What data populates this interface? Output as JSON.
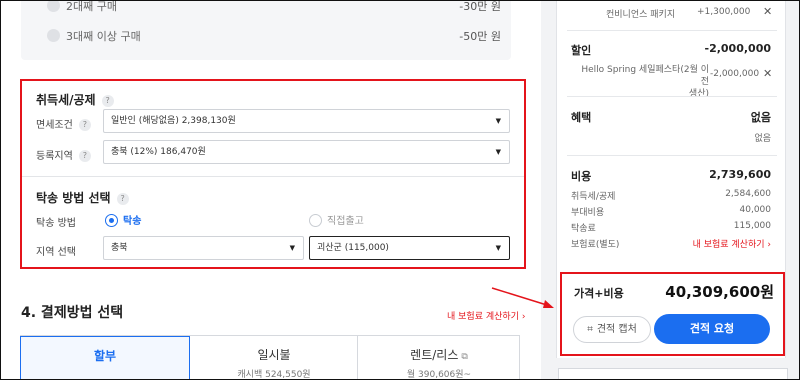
{
  "prev_options": {
    "row1_label": "2대째 구매",
    "row1_value": "-30만 원",
    "row2_label": "3대째 이상 구매",
    "row2_value": "-50만 원"
  },
  "acquisition": {
    "title": "취득세/공제",
    "help": "?",
    "exemption_label": "면세조건",
    "exemption_value": "일반인 (해당없음)   2,398,130원",
    "region_label": "등록지역",
    "region_value": "충북 (12%)   186,470원"
  },
  "delivery": {
    "title": "탁송 방법 선택",
    "method_label": "탁송 방법",
    "option_delivery": "탁송",
    "option_pickup": "직접출고",
    "area_label": "지역 선택",
    "province_value": "충북",
    "district_value": "괴산군 (115,000)"
  },
  "payment": {
    "title": "4. 결제방법 선택",
    "insurance_link": "내 보험료 계산하기  ›",
    "tabs": [
      {
        "label": "할부",
        "sub": ""
      },
      {
        "label": "일시불",
        "sub": "캐시백 524,550원"
      },
      {
        "label": "렌트/리스",
        "sub": "월 390,606원~"
      }
    ]
  },
  "summary": {
    "package_label": "컨비니언스 패키지",
    "package_value": "+1,300,000",
    "discount_title": "할인",
    "discount_total": "-2,000,000",
    "discount_item_line1": "Hello Spring 세일페스타(2월 이전",
    "discount_item_line2": "생산)",
    "discount_item_value": "-2,000,000",
    "benefit_title": "혜택",
    "benefit_value": "없음",
    "benefit_sub": "없음",
    "cost_title": "비용",
    "cost_total": "2,739,600",
    "cost_items": [
      {
        "label": "취득세/공제",
        "value": "2,584,600"
      },
      {
        "label": "부대비용",
        "value": "40,000"
      },
      {
        "label": "탁송료",
        "value": "115,000"
      },
      {
        "label": "보험료(별도)",
        "value": "내 보험료 계산하기  ›"
      }
    ],
    "price_label": "가격+비용",
    "price_value": "40,309,600원",
    "capture_button": "견적 캡처",
    "quote_button": "견적 요청"
  },
  "colors": {
    "accent": "#1b6ef0",
    "highlight_red": "#e4141b"
  },
  "icons": {
    "close": "close-icon",
    "help": "help-icon",
    "caret": "caret-down-icon",
    "capture": "crop-icon",
    "external": "external-link-icon"
  }
}
